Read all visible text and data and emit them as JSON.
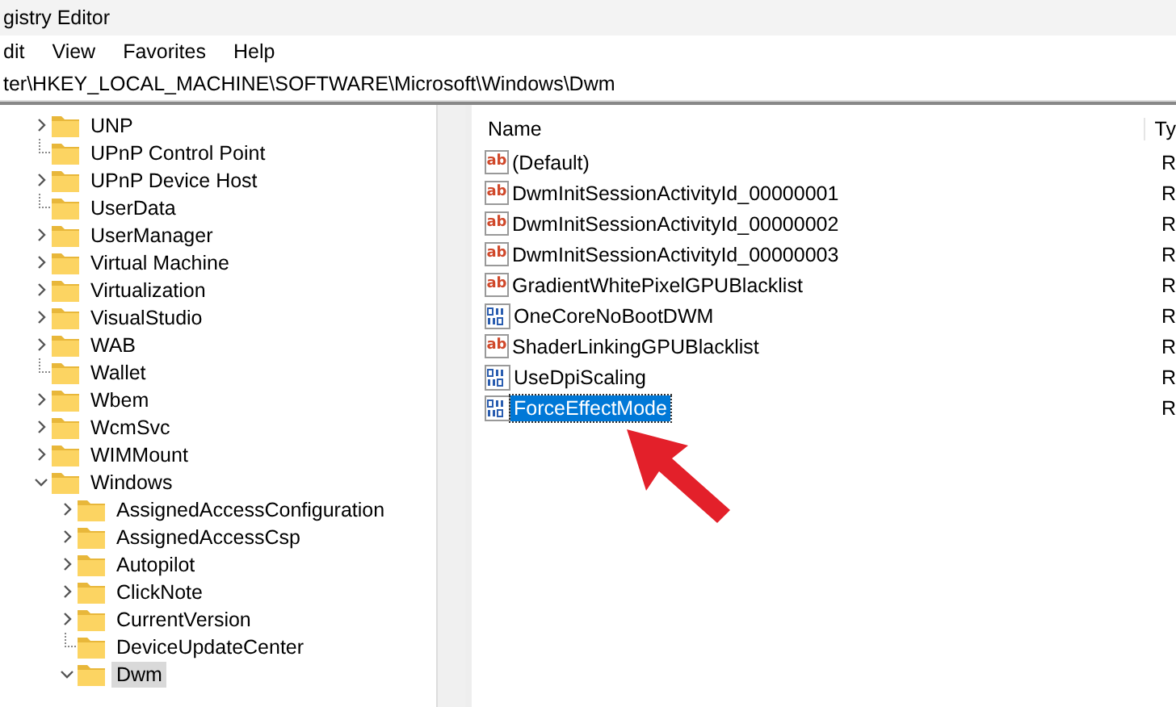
{
  "window": {
    "title": "gistry Editor"
  },
  "menu": [
    "dit",
    "View",
    "Favorites",
    "Help"
  ],
  "address": "ter\\HKEY_LOCAL_MACHINE\\SOFTWARE\\Microsoft\\Windows\\Dwm",
  "tree": [
    {
      "label": "UNP",
      "has_children": true,
      "expanded": false,
      "selected": false
    },
    {
      "label": "UPnP Control Point",
      "has_children": false,
      "selected": false
    },
    {
      "label": "UPnP Device Host",
      "has_children": true,
      "expanded": false,
      "selected": false
    },
    {
      "label": "UserData",
      "has_children": false,
      "selected": false
    },
    {
      "label": "UserManager",
      "has_children": true,
      "expanded": false,
      "selected": false
    },
    {
      "label": "Virtual Machine",
      "has_children": true,
      "expanded": false,
      "selected": false
    },
    {
      "label": "Virtualization",
      "has_children": true,
      "expanded": false,
      "selected": false
    },
    {
      "label": "VisualStudio",
      "has_children": true,
      "expanded": false,
      "selected": false
    },
    {
      "label": "WAB",
      "has_children": true,
      "expanded": false,
      "selected": false
    },
    {
      "label": "Wallet",
      "has_children": false,
      "selected": false
    },
    {
      "label": "Wbem",
      "has_children": true,
      "expanded": false,
      "selected": false
    },
    {
      "label": "WcmSvc",
      "has_children": true,
      "expanded": false,
      "selected": false
    },
    {
      "label": "WIMMount",
      "has_children": true,
      "expanded": false,
      "selected": false
    },
    {
      "label": "Windows",
      "has_children": true,
      "expanded": true,
      "selected": false,
      "children": [
        {
          "label": "AssignedAccessConfiguration",
          "has_children": true,
          "expanded": false,
          "selected": false
        },
        {
          "label": "AssignedAccessCsp",
          "has_children": true,
          "expanded": false,
          "selected": false
        },
        {
          "label": "Autopilot",
          "has_children": true,
          "expanded": false,
          "selected": false
        },
        {
          "label": "ClickNote",
          "has_children": true,
          "expanded": false,
          "selected": false
        },
        {
          "label": "CurrentVersion",
          "has_children": true,
          "expanded": false,
          "selected": false
        },
        {
          "label": "DeviceUpdateCenter",
          "has_children": false,
          "selected": false
        },
        {
          "label": "Dwm",
          "has_children": true,
          "expanded": true,
          "selected": true
        }
      ]
    }
  ],
  "columns": [
    "Name",
    "Ty"
  ],
  "values": [
    {
      "name": "(Default)",
      "kind": "string",
      "icon": "ab",
      "type": "R",
      "selected": false
    },
    {
      "name": "DwmInitSessionActivityId_00000001",
      "kind": "string",
      "icon": "ab",
      "type": "R",
      "selected": false
    },
    {
      "name": "DwmInitSessionActivityId_00000002",
      "kind": "string",
      "icon": "ab",
      "type": "R",
      "selected": false
    },
    {
      "name": "DwmInitSessionActivityId_00000003",
      "kind": "string",
      "icon": "ab",
      "type": "R",
      "selected": false
    },
    {
      "name": "GradientWhitePixelGPUBlacklist",
      "kind": "string",
      "icon": "ab",
      "type": "R",
      "selected": false
    },
    {
      "name": "OneCoreNoBootDWM",
      "kind": "binary",
      "type": "R",
      "selected": false
    },
    {
      "name": "ShaderLinkingGPUBlacklist",
      "kind": "string",
      "icon": "ab",
      "type": "R",
      "selected": false
    },
    {
      "name": "UseDpiScaling",
      "kind": "binary",
      "type": "R",
      "selected": false
    },
    {
      "name": "ForceEffectMode",
      "kind": "binary",
      "type": "R",
      "selected": true
    }
  ]
}
